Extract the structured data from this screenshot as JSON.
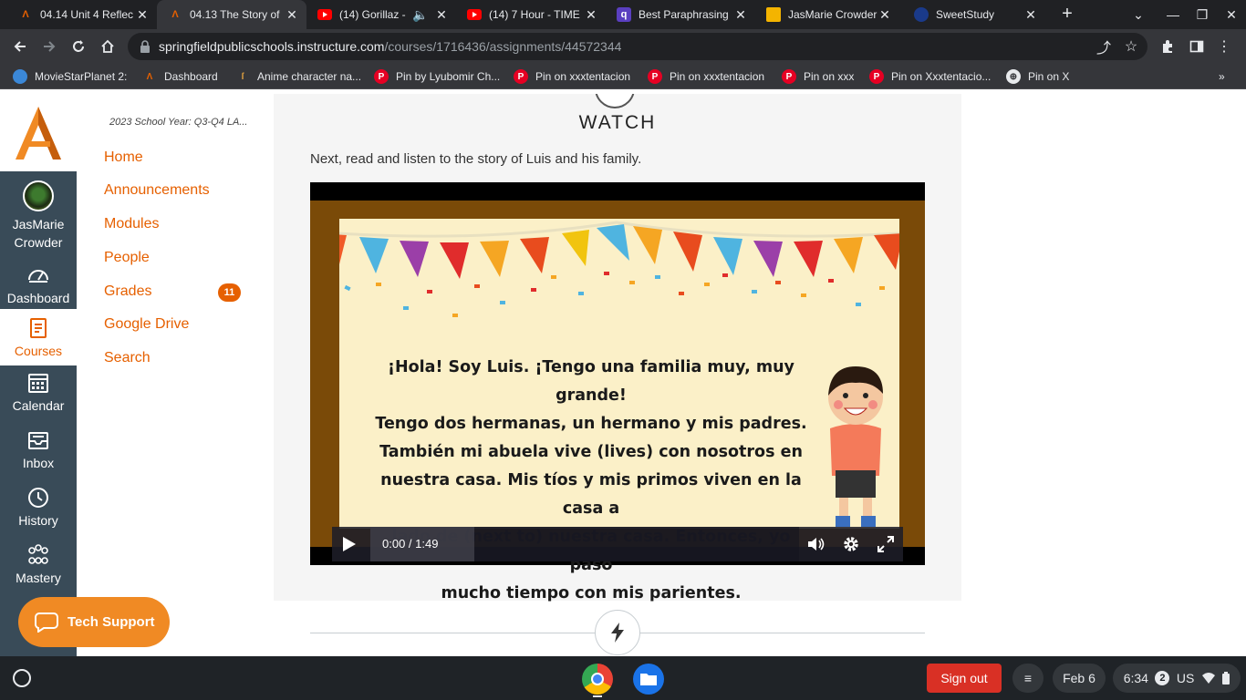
{
  "browser": {
    "tabs": [
      {
        "title": "04.14 Unit 4 Reflec",
        "favicon": "canvas-icon",
        "active": false
      },
      {
        "title": "04.13 The Story of",
        "favicon": "canvas-icon",
        "active": true
      },
      {
        "title": "(14) Gorillaz -",
        "favicon": "youtube-icon",
        "active": false,
        "audio": true
      },
      {
        "title": "(14) 7 Hour - TIME",
        "favicon": "youtube-icon",
        "active": false
      },
      {
        "title": "Best Paraphrasing",
        "favicon": "quillbot-icon",
        "active": false
      },
      {
        "title": "JasMarie Crowder",
        "favicon": "slides-icon",
        "active": false
      },
      {
        "title": "SweetStudy",
        "favicon": "sweetstudy-icon",
        "active": false
      }
    ],
    "url_domain": "springfieldpublicschools.instructure.com",
    "url_path": "/courses/1716436/assignments/44572344",
    "bookmarks": [
      {
        "label": "MovieStarPlanet 2:",
        "icon": "globe-icon"
      },
      {
        "label": "Dashboard",
        "icon": "canvas-icon"
      },
      {
        "label": "Anime character na...",
        "icon": "page-icon"
      },
      {
        "label": "Pin by Lyubomir Ch...",
        "icon": "pinterest-icon"
      },
      {
        "label": "Pin on xxxtentacion",
        "icon": "pinterest-icon"
      },
      {
        "label": "Pin on xxxtentacion",
        "icon": "pinterest-icon"
      },
      {
        "label": "Pin on xxx",
        "icon": "pinterest-icon"
      },
      {
        "label": "Pin on Xxxtentacio...",
        "icon": "pinterest-icon"
      },
      {
        "label": "Pin on X",
        "icon": "globe-icon"
      }
    ]
  },
  "global_nav": {
    "user_name_line1": "JasMarie",
    "user_name_line2": "Crowder",
    "items": [
      {
        "label": "Dashboard",
        "icon": "dashboard-icon"
      },
      {
        "label": "Courses",
        "icon": "courses-icon",
        "active": true
      },
      {
        "label": "Calendar",
        "icon": "calendar-icon"
      },
      {
        "label": "Inbox",
        "icon": "inbox-icon"
      },
      {
        "label": "History",
        "icon": "history-icon"
      },
      {
        "label": "Mastery",
        "icon": "mastery-icon"
      }
    ]
  },
  "course_nav": {
    "term": "2023 School Year: Q3-Q4 LA...",
    "links": [
      "Home",
      "Announcements",
      "Modules",
      "People",
      "Grades",
      "Google Drive",
      "Search"
    ],
    "grades_badge": "11"
  },
  "content": {
    "section_title": "WATCH",
    "lead": "Next, read and listen to the story of Luis and his family.",
    "video": {
      "story_lines": [
        "¡Hola! Soy Luis. ¡Tengo una familia muy, muy grande!",
        "Tengo dos hermanas, un hermano y mis padres.",
        "También mi abuela vive (lives) con nosotros en",
        "nuestra casa. Mis tíos y mis primos viven en la casa a",
        "lado de (next to) nuestra casa. Entonces, yo paso",
        "mucho tiempo con mis parientes."
      ],
      "time": "0:00 / 1:49",
      "progress": 0
    }
  },
  "tech_support": "Tech Support",
  "shelf": {
    "sign_out": "Sign out",
    "date": "Feb 6",
    "time": "6:34",
    "notifications": "2",
    "keyboard": "US"
  }
}
